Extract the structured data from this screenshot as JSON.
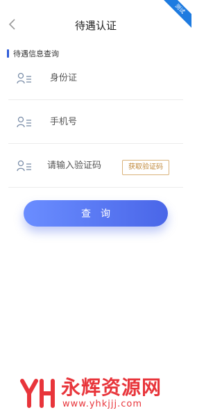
{
  "header": {
    "title": "待遇认证",
    "corner_badge": "测试"
  },
  "section": {
    "heading": "待遇信息查询"
  },
  "form": {
    "id_placeholder": "身份证",
    "phone_placeholder": "手机号",
    "code_placeholder": "请输入验证码",
    "get_code_label": "获取验证码",
    "query_label": "查询"
  },
  "watermark": {
    "name": "永辉资源网",
    "url": "www.yhkjjj.com"
  },
  "colors": {
    "accent": "#4a66e8",
    "code_button": "#c0883a",
    "watermark": "#e8353b"
  }
}
